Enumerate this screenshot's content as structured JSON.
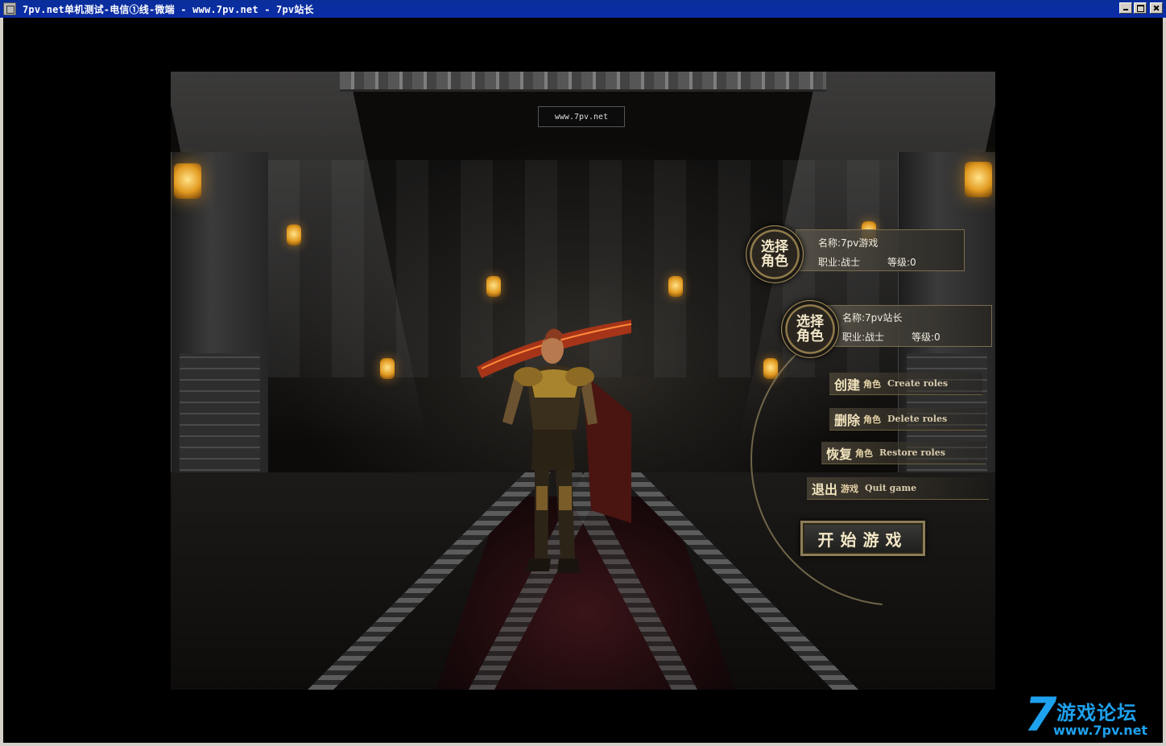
{
  "window": {
    "title": "7pv.net单机测试-电信①线-微端 - www.7pv.net - 7pv站长"
  },
  "scene": {
    "site_badge": "www.7pv.net"
  },
  "characters": [
    {
      "select_label_1": "选择",
      "select_label_2": "角色",
      "name": "名称:7pv游戏",
      "class": "职业:战士",
      "level": "等级:0"
    },
    {
      "select_label_1": "选择",
      "select_label_2": "角色",
      "name": "名称:7pv站长",
      "class": "职业:战士",
      "level": "等级:0"
    }
  ],
  "menu": {
    "create": {
      "cn_big": "创建",
      "cn_small": "角色",
      "en": "Create roles"
    },
    "delete": {
      "cn_big": "删除",
      "cn_small": "角色",
      "en": "Delete roles"
    },
    "restore": {
      "cn_big": "恢复",
      "cn_small": "角色",
      "en": "Restore roles"
    },
    "quit": {
      "cn_big": "退出",
      "cn_small": "游戏",
      "en": "Quit game"
    },
    "start": "开始游戏"
  },
  "watermark": {
    "digit": "7",
    "cn": "游戏论坛",
    "url": "www.7pv.net"
  },
  "colors": {
    "title_bar": "#0b2ca8",
    "gold_text": "#f1e3bd",
    "watermark_blue": "#1ea1ee"
  }
}
